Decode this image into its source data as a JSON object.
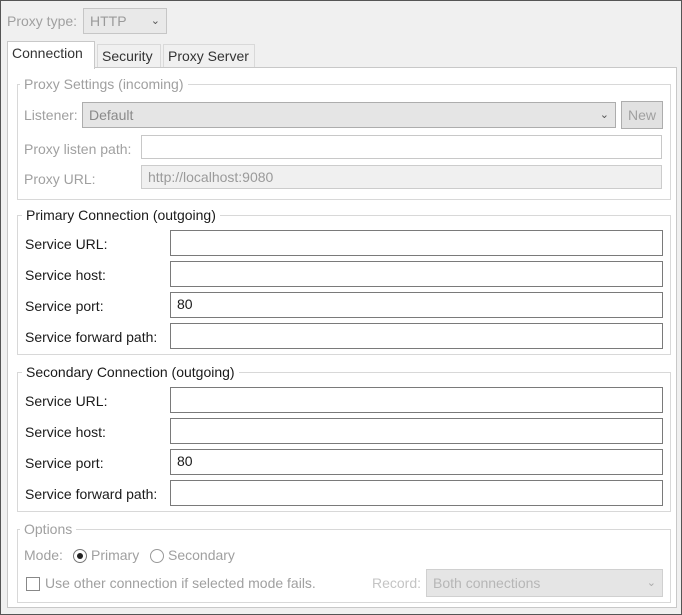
{
  "proxy_type": {
    "label": "Proxy type:",
    "value": "HTTP"
  },
  "tabs": [
    {
      "label": "Connection",
      "active": true
    },
    {
      "label": "Security",
      "active": false
    },
    {
      "label": "Proxy Server",
      "active": false
    }
  ],
  "proxy_settings": {
    "title": "Proxy Settings (incoming)",
    "listener_label": "Listener:",
    "listener_value": "Default",
    "new_button": "New",
    "listen_path_label": "Proxy listen path:",
    "listen_path_value": "",
    "proxy_url_label": "Proxy URL:",
    "proxy_url_value": "http://localhost:9080"
  },
  "primary": {
    "title": "Primary Connection (outgoing)",
    "service_url_label": "Service URL:",
    "service_url_value": "",
    "service_host_label": "Service host:",
    "service_host_value": "",
    "service_port_label": "Service port:",
    "service_port_value": "80",
    "forward_path_label": "Service forward path:",
    "forward_path_value": ""
  },
  "secondary": {
    "title": "Secondary Connection (outgoing)",
    "service_url_label": "Service URL:",
    "service_url_value": "",
    "service_host_label": "Service host:",
    "service_host_value": "",
    "service_port_label": "Service port:",
    "service_port_value": "80",
    "forward_path_label": "Service forward path:",
    "forward_path_value": ""
  },
  "options": {
    "title": "Options",
    "mode_label": "Mode:",
    "mode_primary": "Primary",
    "mode_secondary": "Secondary",
    "selected_mode": "Primary",
    "fallback_label": "Use other connection if selected mode fails.",
    "fallback_checked": false,
    "record_label": "Record:",
    "record_value": "Both connections"
  },
  "colors": {
    "window_bg": "#f0f0f0",
    "panel_bg": "#ffffff",
    "disabled_text": "#a0a0a0"
  }
}
